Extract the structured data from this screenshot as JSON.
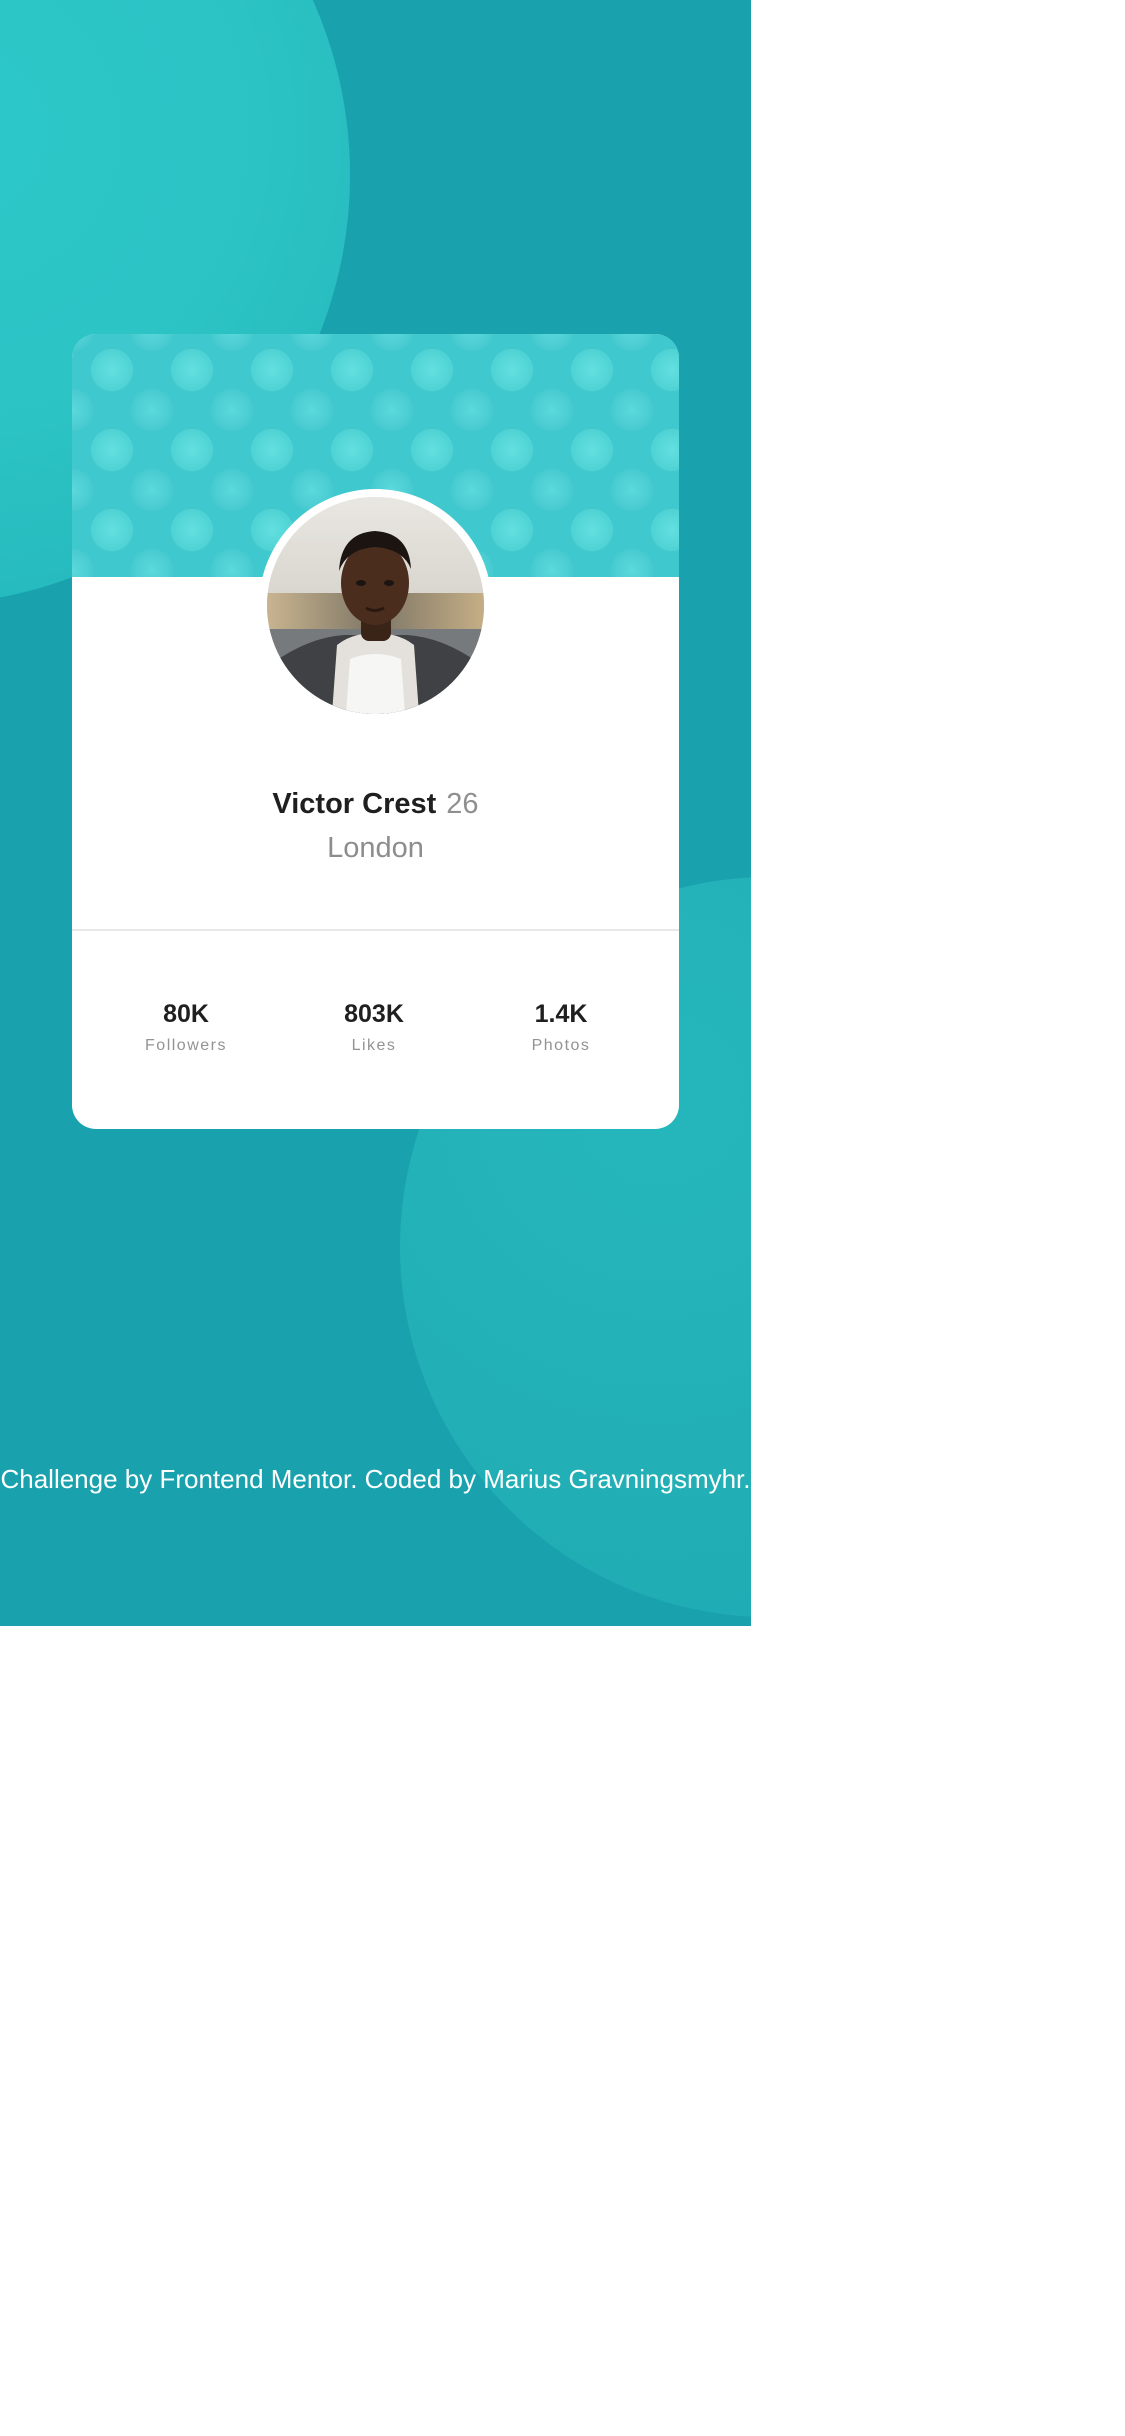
{
  "colors": {
    "background": "#19a2ae",
    "header_pattern": "#3fc8ce",
    "card": "#ffffff",
    "text_dark": "#1f1f1f",
    "text_muted": "#8f8f8f"
  },
  "profile": {
    "name": "Victor Crest",
    "age": "26",
    "location": "London",
    "avatar_icon": "user-photo"
  },
  "stats": [
    {
      "value": "80K",
      "label": "Followers"
    },
    {
      "value": "803K",
      "label": "Likes"
    },
    {
      "value": "1.4K",
      "label": "Photos"
    }
  ],
  "footer": {
    "attribution": "Challenge by Frontend Mentor. Coded by Marius Gravningsmyhr."
  }
}
